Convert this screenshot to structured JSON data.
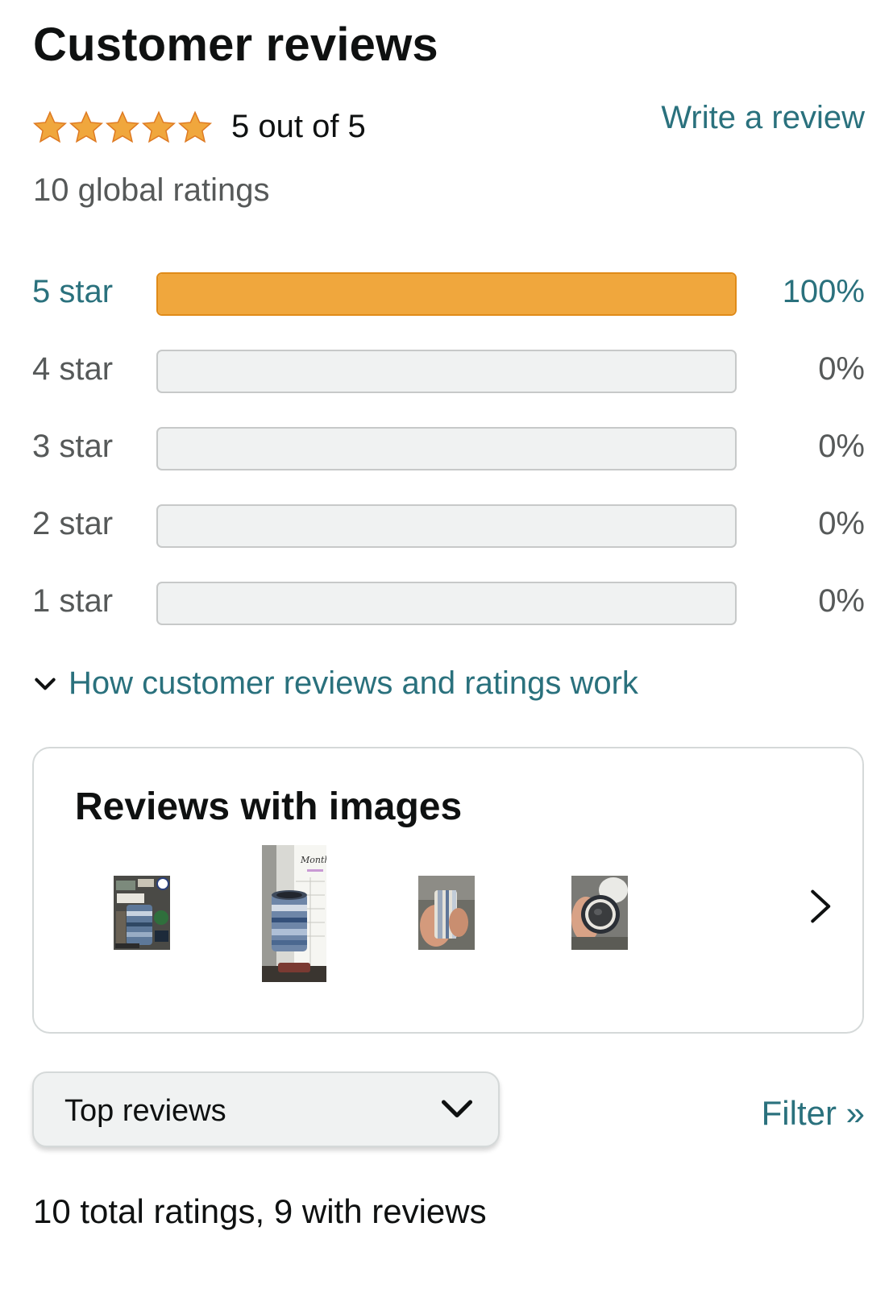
{
  "header": {
    "title": "Customer reviews",
    "average_text": "5 out of 5",
    "rating_value": 5,
    "rating_max": 5,
    "write_review": "Write a review",
    "global_ratings": "10 global ratings"
  },
  "histogram": [
    {
      "label": "5 star",
      "percent_text": "100%",
      "percent": 100
    },
    {
      "label": "4 star",
      "percent_text": "0%",
      "percent": 0
    },
    {
      "label": "3 star",
      "percent_text": "0%",
      "percent": 0
    },
    {
      "label": "2 star",
      "percent_text": "0%",
      "percent": 0
    },
    {
      "label": "1 star",
      "percent_text": "0%",
      "percent": 0
    }
  ],
  "how_it_works": "How customer reviews and ratings work",
  "images_section": {
    "title": "Reviews with images",
    "thumbnails": [
      "review-photo-1",
      "review-photo-2",
      "review-photo-3",
      "review-photo-4"
    ],
    "next_icon": "chevron-right-icon"
  },
  "sort": {
    "selected": "Top reviews",
    "caret_icon": "chevron-down-icon"
  },
  "filter": "Filter »",
  "totals": "10 total ratings, 9 with reviews",
  "colors": {
    "link": "#2a717d",
    "star": "#f0a73d",
    "bar_fill": "#f0a73d",
    "bar_empty": "#f0f2f2",
    "text": "#0f1111",
    "muted": "#565959"
  }
}
